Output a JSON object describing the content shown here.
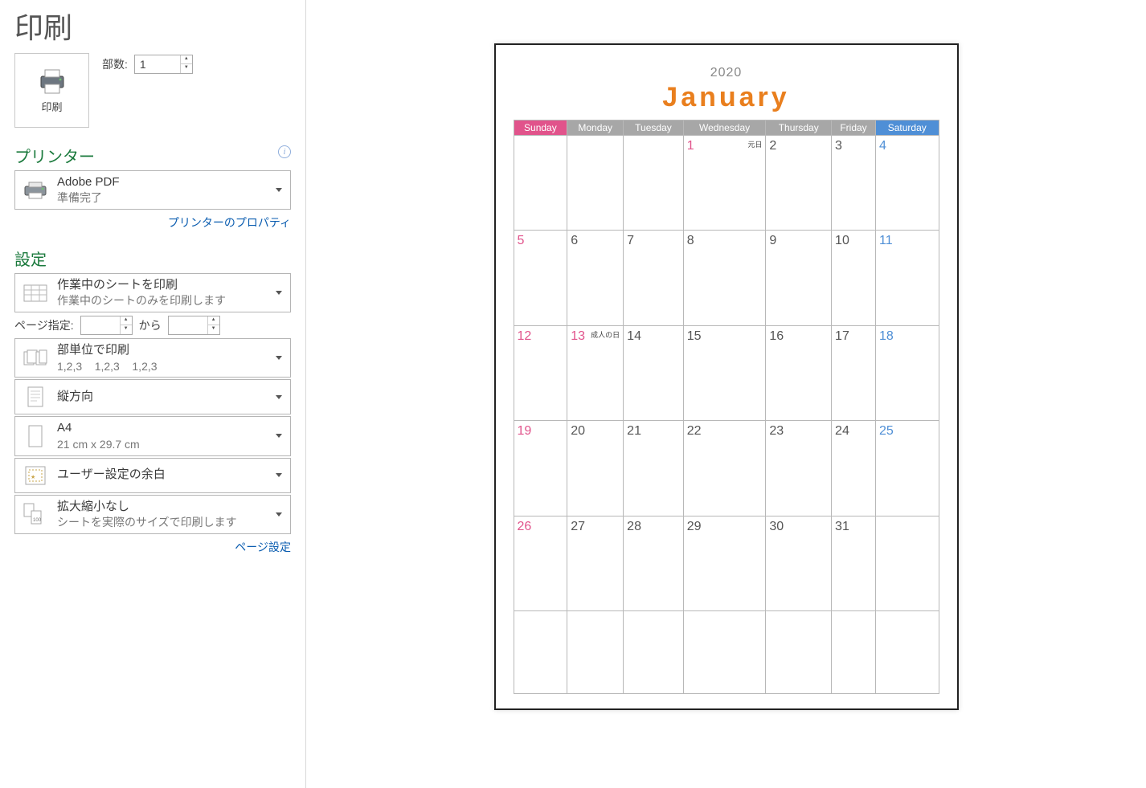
{
  "title": "印刷",
  "print_button_label": "印刷",
  "copies": {
    "label": "部数:",
    "value": "1"
  },
  "printer": {
    "section_label": "プリンター",
    "name": "Adobe PDF",
    "status": "準備完了",
    "properties_link": "プリンターのプロパティ"
  },
  "settings": {
    "section_label": "設定",
    "print_what": {
      "main": "作業中のシートを印刷",
      "sub": "作業中のシートのみを印刷します"
    },
    "page_range": {
      "label": "ページ指定:",
      "from_value": "",
      "to_label": "から",
      "to_value": ""
    },
    "collate": {
      "main": "部単位で印刷",
      "sub": "1,2,3    1,2,3    1,2,3"
    },
    "orientation": {
      "main": "縦方向"
    },
    "paper": {
      "main": "A4",
      "sub": "21 cm x 29.7 cm"
    },
    "margins": {
      "main": "ユーザー設定の余白"
    },
    "scaling": {
      "main": "拡大縮小なし",
      "sub": "シートを実際のサイズで印刷します"
    },
    "page_setup_link": "ページ設定"
  },
  "calendar": {
    "year": "2020",
    "month": "January",
    "weekdays": [
      "Sunday",
      "Monday",
      "Tuesday",
      "Wednesday",
      "Thursday",
      "Friday",
      "Saturday"
    ],
    "weeks": [
      [
        {
          "n": ""
        },
        {
          "n": ""
        },
        {
          "n": ""
        },
        {
          "n": "1",
          "note": "元日",
          "cls": "sun"
        },
        {
          "n": "2"
        },
        {
          "n": "3"
        },
        {
          "n": "4",
          "cls": "sat"
        }
      ],
      [
        {
          "n": "5",
          "cls": "sun"
        },
        {
          "n": "6"
        },
        {
          "n": "7"
        },
        {
          "n": "8"
        },
        {
          "n": "9"
        },
        {
          "n": "10"
        },
        {
          "n": "11",
          "cls": "sat"
        }
      ],
      [
        {
          "n": "12",
          "cls": "sun"
        },
        {
          "n": "13",
          "note": "成人の日",
          "cls": "sun"
        },
        {
          "n": "14"
        },
        {
          "n": "15"
        },
        {
          "n": "16"
        },
        {
          "n": "17"
        },
        {
          "n": "18",
          "cls": "sat"
        }
      ],
      [
        {
          "n": "19",
          "cls": "sun"
        },
        {
          "n": "20"
        },
        {
          "n": "21"
        },
        {
          "n": "22"
        },
        {
          "n": "23"
        },
        {
          "n": "24"
        },
        {
          "n": "25",
          "cls": "sat"
        }
      ],
      [
        {
          "n": "26",
          "cls": "sun"
        },
        {
          "n": "27"
        },
        {
          "n": "28"
        },
        {
          "n": "29"
        },
        {
          "n": "30"
        },
        {
          "n": "31"
        },
        {
          "n": ""
        }
      ],
      [
        {
          "n": ""
        },
        {
          "n": ""
        },
        {
          "n": ""
        },
        {
          "n": ""
        },
        {
          "n": ""
        },
        {
          "n": ""
        },
        {
          "n": ""
        }
      ]
    ]
  }
}
